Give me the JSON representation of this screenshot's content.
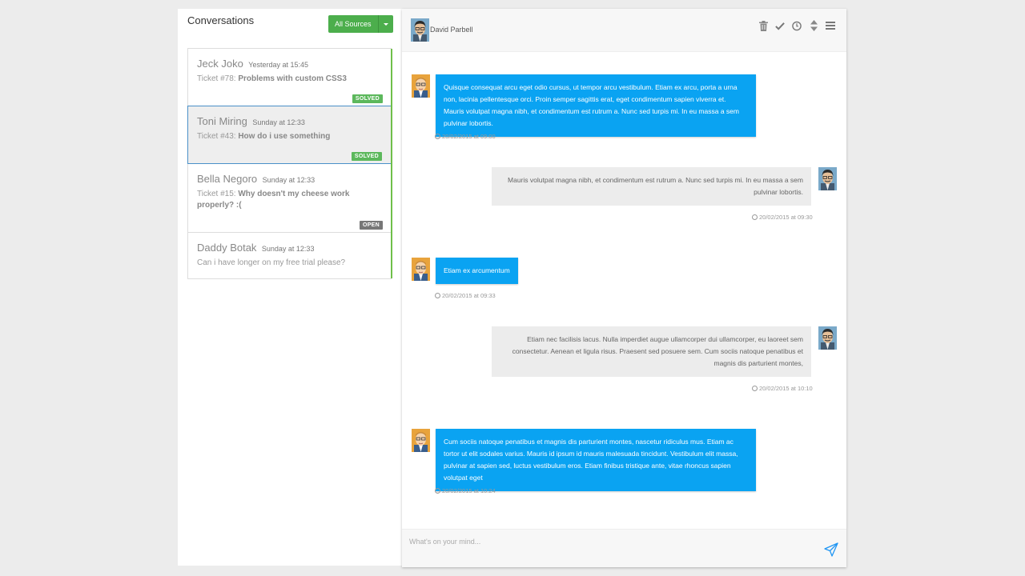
{
  "left": {
    "title": "Conversations",
    "sources_label": "All Sources",
    "conversations": [
      {
        "name": "Jeck Joko",
        "time": "Yesterday at 15:45",
        "ticket_prefix": "Ticket #78:",
        "ticket_subject": "Problems with custom CSS3",
        "status": "SOLVED"
      },
      {
        "name": "Toni Miring",
        "time": "Sunday at 12:33",
        "ticket_prefix": "Ticket #43:",
        "ticket_subject": "How do i use something",
        "status": "SOLVED"
      },
      {
        "name": "Bella Negoro",
        "time": "Sunday at 12:33",
        "ticket_prefix": "Ticket #15:",
        "ticket_subject": "Why doesn't my cheese work properly? :(",
        "status": "OPEN"
      },
      {
        "name": "Daddy Botak",
        "time": "Sunday at 12:33",
        "message": "Can i have longer on my free trial please?"
      }
    ]
  },
  "chat": {
    "contact_name": "David Parbell",
    "header_icons": [
      "trash-icon",
      "check-icon",
      "clock-icon",
      "sort-icon",
      "menu-icon"
    ],
    "messages": [
      {
        "direction": "in",
        "text": "Quisque consequat arcu eget odio cursus, ut tempor arcu vestibulum. Etiam ex arcu, porta a urna non, lacinia pellentesque orci. Proin semper sagittis erat, eget condimentum sapien viverra et. Mauris volutpat magna nibh, et condimentum est rutrum a. Nunc sed turpis mi. In eu massa a sem pulvinar lobortis.",
        "timestamp": "20/02/2015 at 09:00"
      },
      {
        "direction": "out",
        "text": "Mauris volutpat magna nibh, et condimentum est rutrum a. Nunc sed turpis mi. In eu massa a sem pulvinar lobortis.",
        "timestamp": "20/02/2015 at 09:30"
      },
      {
        "direction": "in",
        "text": "Etiam ex arcumentum",
        "timestamp": "20/02/2015 at 09:33"
      },
      {
        "direction": "out",
        "text": "Etiam nec facilisis lacus. Nulla imperdiet augue ullamcorper dui ullamcorper, eu laoreet sem consectetur. Aenean et ligula risus. Praesent sed posuere sem. Cum sociis natoque penatibus et magnis dis parturient montes,",
        "timestamp": "20/02/2015 at 10:10"
      },
      {
        "direction": "in",
        "text": "Cum sociis natoque penatibus et magnis dis parturient montes, nascetur ridiculus mus. Etiam ac tortor ut elit sodales varius. Mauris id ipsum id mauris malesuada tincidunt. Vestibulum elit massa, pulvinar at sapien sed, luctus vestibulum eros. Etiam finibus tristique ante, vitae rhoncus sapien volutpat eget",
        "timestamp": "20/02/2015 at 10:24"
      }
    ],
    "compose_placeholder": "What's on your mind..."
  },
  "colors": {
    "accent_green": "#5cb85c",
    "bubble_blue": "#0aa3f2",
    "active_border": "#4a90c8"
  }
}
